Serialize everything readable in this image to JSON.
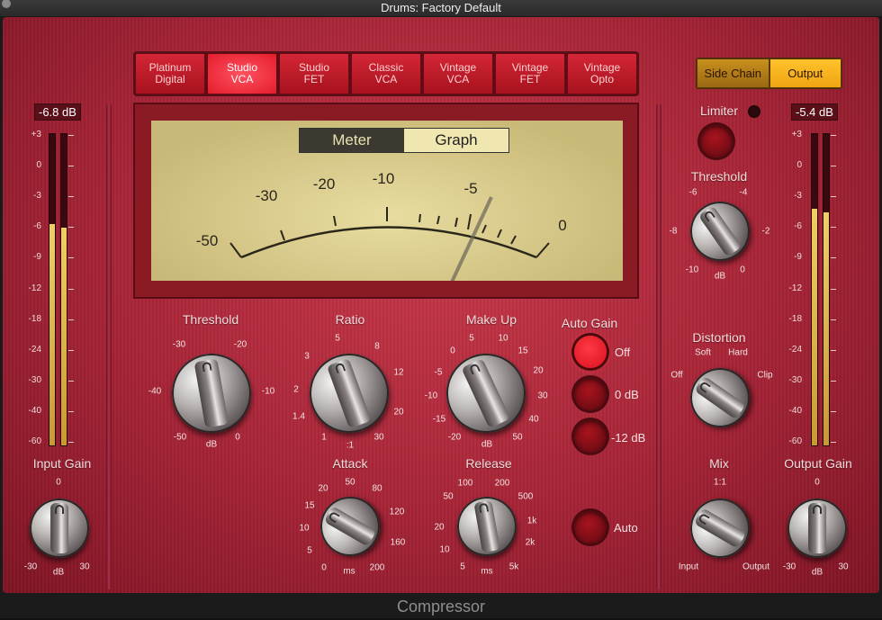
{
  "window": {
    "title": "Drums: Factory Default",
    "footer": "Compressor"
  },
  "models": [
    {
      "label": "Platinum\nDigital",
      "active": false
    },
    {
      "label": "Studio\nVCA",
      "active": true
    },
    {
      "label": "Studio\nFET",
      "active": false
    },
    {
      "label": "Classic\nVCA",
      "active": false
    },
    {
      "label": "Vintage\nVCA",
      "active": false
    },
    {
      "label": "Vintage\nFET",
      "active": false
    },
    {
      "label": "Vintage\nOpto",
      "active": false
    }
  ],
  "sidechain": {
    "side_chain": "Side Chain",
    "output": "Output",
    "selected": "Output"
  },
  "input_meter": {
    "readout": "-6.8 dB",
    "level": 0.71
  },
  "output_meter": {
    "readout": "-5.4 dB",
    "level": 0.76
  },
  "meter_scale": [
    "+3",
    "0",
    "-3",
    "-6",
    "-9",
    "-12",
    "-18",
    "-24",
    "-30",
    "-40",
    "-60"
  ],
  "meter_view": {
    "meter": "Meter",
    "graph": "Graph",
    "selected": "Meter"
  },
  "vu_scale": [
    "-50",
    "-30",
    "-20",
    "-10",
    "-5",
    "0"
  ],
  "threshold": {
    "label": "Threshold",
    "ticks": [
      "-30",
      "-20",
      "-40",
      "-10",
      "-50",
      "0"
    ],
    "unit": "dB"
  },
  "ratio": {
    "label": "Ratio",
    "ticks": [
      "5",
      "8",
      "3",
      "12",
      "2",
      "20",
      "1.4",
      "30",
      "1"
    ],
    "unit": ":1"
  },
  "makeup": {
    "label": "Make Up",
    "ticks": [
      "0",
      "5",
      "10",
      "15",
      "-5",
      "20",
      "-10",
      "30",
      "-15",
      "40",
      "-20",
      "50"
    ],
    "unit": "dB"
  },
  "auto_gain": {
    "label": "Auto Gain",
    "options": [
      "Off",
      "0 dB",
      "-12 dB"
    ],
    "selected": "Off"
  },
  "attack": {
    "label": "Attack",
    "ticks": [
      "20",
      "50",
      "80",
      "15",
      "120",
      "10",
      "5",
      "160",
      "0",
      "200"
    ],
    "unit": "ms"
  },
  "release": {
    "label": "Release",
    "ticks": [
      "100",
      "200",
      "50",
      "500",
      "20",
      "1k",
      "10",
      "2k",
      "5",
      "5k"
    ],
    "unit": "ms"
  },
  "auto": {
    "label": "Auto"
  },
  "input_gain": {
    "label": "Input Gain",
    "ticks": [
      "0",
      "-30",
      "30"
    ],
    "unit": "dB"
  },
  "output_gain": {
    "label": "Output Gain",
    "ticks": [
      "0",
      "-30",
      "30"
    ],
    "unit": "dB"
  },
  "limiter": {
    "label": "Limiter"
  },
  "lim_threshold": {
    "label": "Threshold",
    "ticks": [
      "-6",
      "-4",
      "-8",
      "-2",
      "-10",
      "0"
    ],
    "unit": "dB"
  },
  "distortion": {
    "label": "Distortion",
    "ticks": [
      "Soft",
      "Hard",
      "Off",
      "Clip"
    ]
  },
  "mix": {
    "label": "Mix",
    "ticks": [
      "1:1",
      "Input",
      "Output"
    ]
  }
}
